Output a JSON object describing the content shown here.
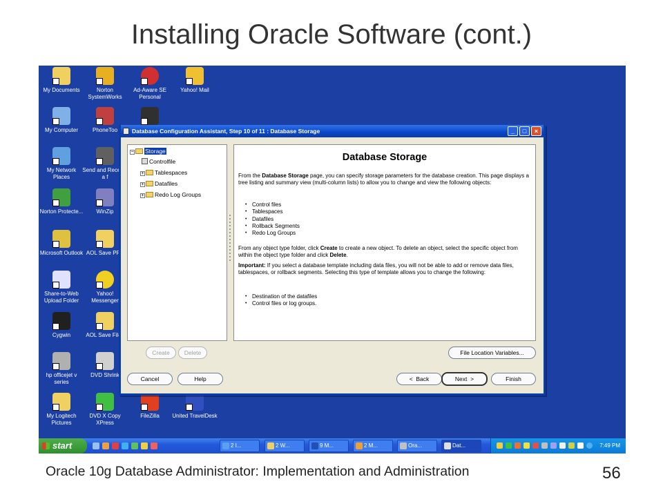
{
  "slide": {
    "title": "Installing Oracle Software (cont.)",
    "footer": "Oracle 10g Database Administrator: Implementation and Administration",
    "page_number": "56"
  },
  "desktop_icons": [
    {
      "label": "My Documents",
      "color": "#f0d060"
    },
    {
      "label": "Norton SystemWorks",
      "color": "#e8b020"
    },
    {
      "label": "Ad-Aware SE Personal",
      "color": "#d03030"
    },
    {
      "label": "Yahoo! Mail",
      "color": "#f0c030"
    },
    {
      "label": "My Computer",
      "color": "#7fb0e8"
    },
    {
      "label": "PhoneToo",
      "color": "#c04040"
    },
    {
      "label": "",
      "color": "#303030"
    },
    {
      "label": "My Network Places",
      "color": "#60a0e0"
    },
    {
      "label": "Send and Receive a f",
      "color": "#606060"
    },
    {
      "label": "Norton Protecte...",
      "color": "#40a040"
    },
    {
      "label": "WinZip",
      "color": "#8080c0"
    },
    {
      "label": "Microsoft Outlook",
      "color": "#e0c040"
    },
    {
      "label": "AOL Save PFC",
      "color": "#f0d060"
    },
    {
      "label": "Share-to-Web Upload Folder",
      "color": "#e0e0ff"
    },
    {
      "label": "Yahoo! Messenger",
      "color": "#f0d020"
    },
    {
      "label": "Cygwin",
      "color": "#202020"
    },
    {
      "label": "AOL Save Files",
      "color": "#f0d060"
    },
    {
      "label": "hp officejet v series",
      "color": "#b0b0b0"
    },
    {
      "label": "DVD Shrink",
      "color": "#d0d0d0"
    },
    {
      "label": "My Logitech Pictures",
      "color": "#f0d060"
    },
    {
      "label": "DVD X Copy XPress",
      "color": "#40c040"
    },
    {
      "label": "FileZilla",
      "color": "#e04020"
    },
    {
      "label": "United TravelDesk",
      "color": "#3050c0"
    }
  ],
  "dialog": {
    "title": "Database Configuration Assistant, Step 10 of 11 : Database Storage",
    "controls": {
      "minimize": "_",
      "maximize": "□",
      "close": "×"
    },
    "tree": {
      "root": "Storage",
      "children": [
        "Controlfile",
        "Tablespaces",
        "Datafiles",
        "Redo Log Groups"
      ]
    },
    "content": {
      "heading": "Database Storage",
      "intro": {
        "p1": "From the ",
        "b1": "Database Storage",
        "p2": " page, you can specify storage parameters for the database creation. This page displays a tree listing and summary view (multi-column lists) to allow you to change and view the following objects:"
      },
      "objects": [
        "Control files",
        "Tablespaces",
        "Datafiles",
        "Rollback Segments",
        "Redo Log Groups"
      ],
      "create_text": {
        "p1": "From any object type folder, click ",
        "b1": "Create",
        "p2": " to create a new object. To delete an object, select the specific object from within the object type folder and click ",
        "b2": "Delete",
        "p3": "."
      },
      "important": {
        "b1": "Important:",
        "p1": " If you select a database template including data files, you will not be able to add or remove data files, tablespaces, or rollback segments. Selecting this type of template allows you to change the following:"
      },
      "changes": [
        "Destination of the datafiles",
        "Control files or log groups."
      ]
    },
    "buttons": {
      "create": "Create",
      "delete": "Delete",
      "file_location": "File Location Variables...",
      "cancel": "Cancel",
      "help": "Help",
      "back": "Back",
      "back_arrow": "<",
      "next": "Next",
      "next_arrow": ">",
      "finish": "Finish"
    }
  },
  "taskbar": {
    "start": "start",
    "tasks": [
      "2 I...",
      "2 W...",
      "9 M...",
      "2 M...",
      "Ora...",
      "Dat..."
    ],
    "clock": "7:49 PM"
  }
}
